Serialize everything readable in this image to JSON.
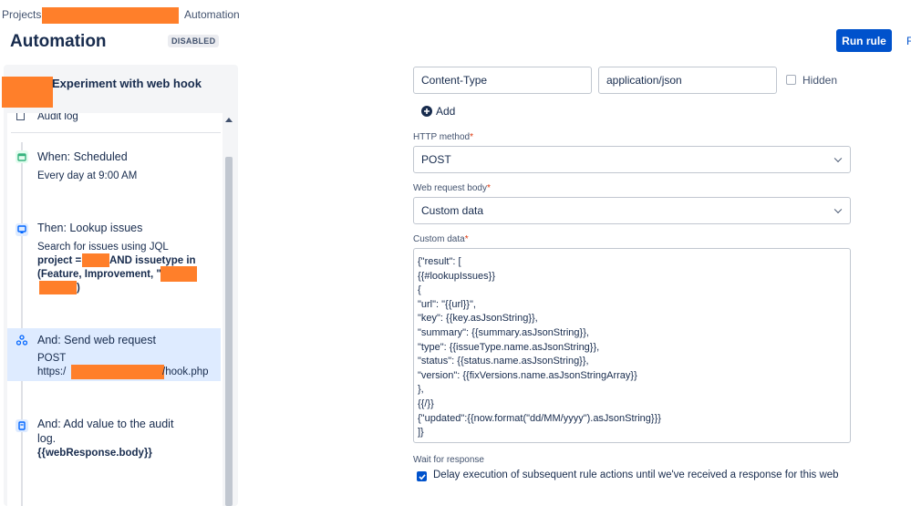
{
  "breadcrumb": {
    "projects": "Projects",
    "automation": "Automation"
  },
  "header": {
    "title": "Automation",
    "status_badge": "DISABLED",
    "run_rule": "Run rule",
    "cut_link": "F"
  },
  "rule": {
    "name": "Experiment with web hook",
    "audit_log": "Audit log",
    "steps": [
      {
        "title": "When: Scheduled",
        "lines": [
          "Every day at 9:00 AM"
        ],
        "icon": "calendar-icon",
        "color": "#36b37e"
      },
      {
        "title": "Then: Lookup issues",
        "lines": [
          "Search for issues using JQL"
        ],
        "bold": [
          "project =",
          "AND issuetype in",
          "(Feature, Improvement, \"",
          ")"
        ],
        "icon": "search-issues-icon",
        "color": "#0065ff"
      },
      {
        "title": "And: Send web request",
        "lines": [
          "POST",
          "https:/",
          "/hook.php"
        ],
        "icon": "webhook-icon",
        "color": "#0065ff"
      },
      {
        "title": "And: Add value to the audit",
        "title2": "log.",
        "bold": [
          "{{webResponse.body}}"
        ],
        "icon": "audit-log-icon",
        "color": "#0065ff"
      }
    ]
  },
  "form": {
    "header_name": "Content-Type",
    "header_value": "application/json",
    "hidden_label": "Hidden",
    "add_label": "Add",
    "http_method_label": "HTTP method",
    "http_method_value": "POST",
    "body_label": "Web request body",
    "body_value": "Custom data",
    "custom_data_label": "Custom data",
    "custom_data_lines": [
      "{\"result\": [",
      "{{#lookupIssues}}",
      "{",
      "\"url\": \"{{url}}\",",
      "\"key\": {{key.asJsonString}},",
      "\"summary\": {{summary.asJsonString}},",
      "\"type\": {{issueType.name.asJsonString}},",
      "\"status\": {{status.name.asJsonString}},",
      "\"version\": {{fixVersions.name.asJsonStringArray}}",
      "},",
      "{{/}}",
      "{\"updated\":{{now.format(\"dd/MM/yyyy\").asJsonString}}}",
      "]}"
    ],
    "wait_label": "Wait for response",
    "delay_text": "Delay execution of subsequent rule actions until we've received a response for this web"
  },
  "colors": {
    "accent": "#0052cc",
    "redaction": "#ff7f2a",
    "selected_step": "#deebff"
  }
}
